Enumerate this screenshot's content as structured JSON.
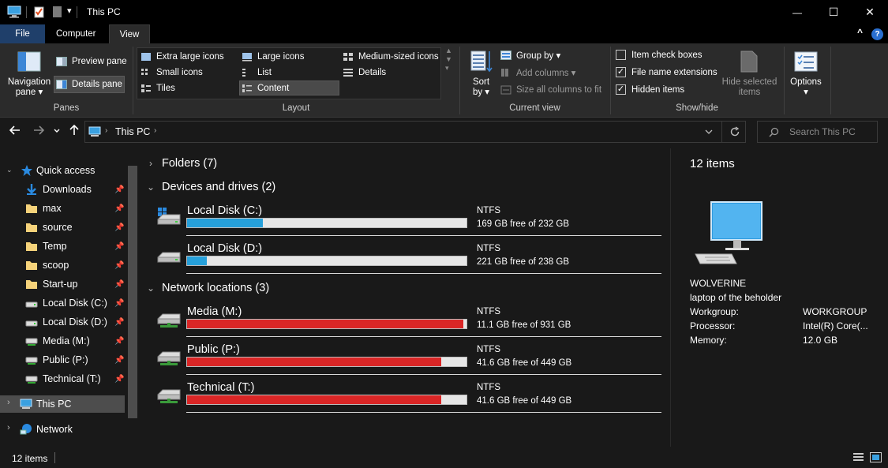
{
  "window": {
    "title": "This PC",
    "quick_access_dropdown": "▾",
    "minimize": "—",
    "maximize": "☐",
    "close": "✕"
  },
  "ribbon_tabs": [
    "File",
    "Computer",
    "View"
  ],
  "ribbon_help": "?",
  "ribbon_collapse": "^",
  "panes": {
    "navigation_pane_line1": "Navigation",
    "navigation_pane_line2": "pane ▾",
    "preview_pane": "Preview pane",
    "details_pane": "Details pane",
    "group_label": "Panes"
  },
  "layout": {
    "options": [
      "Extra large icons",
      "Large icons",
      "Medium-sized icons",
      "Small icons",
      "List",
      "Details",
      "Tiles",
      "Content"
    ],
    "selected": "Content",
    "group_label": "Layout"
  },
  "current_view": {
    "sort_by_line1": "Sort",
    "sort_by_line2": "by ▾",
    "group_by": "Group by ▾",
    "add_columns": "Add columns ▾",
    "size_columns": "Size all columns to fit",
    "group_label": "Current view"
  },
  "show_hide": {
    "item_check_boxes": "Item check boxes",
    "item_check_boxes_checked": false,
    "file_name_extensions": "File name extensions",
    "file_name_extensions_checked": true,
    "hidden_items": "Hidden items",
    "hidden_items_checked": true,
    "hide_selected_line1": "Hide selected",
    "hide_selected_line2": "items",
    "group_label": "Show/hide"
  },
  "options": {
    "label": "Options",
    "arrow": "▾"
  },
  "address": {
    "location": "This PC",
    "search_placeholder": "Search This PC"
  },
  "nav_pane": {
    "quick_access": "Quick access",
    "items": [
      {
        "label": "Downloads",
        "pinned": true
      },
      {
        "label": "max",
        "pinned": true
      },
      {
        "label": "source",
        "pinned": true
      },
      {
        "label": "Temp",
        "pinned": true
      },
      {
        "label": "scoop",
        "pinned": true
      },
      {
        "label": "Start-up",
        "pinned": true
      },
      {
        "label": "Local Disk (C:)",
        "pinned": true
      },
      {
        "label": "Local Disk (D:)",
        "pinned": true
      },
      {
        "label": "Media (M:)",
        "pinned": true
      },
      {
        "label": "Public (P:)",
        "pinned": true
      },
      {
        "label": "Technical (T:)",
        "pinned": true
      }
    ],
    "this_pc": "This PC",
    "network": "Network"
  },
  "content": {
    "folders_header": "Folders (7)",
    "devices_header": "Devices and drives (2)",
    "network_header": "Network locations (3)",
    "drives": [
      {
        "name": "Local Disk (C:)",
        "fs": "NTFS",
        "free": "169 GB free of 232 GB",
        "used_fraction": 0.27,
        "color": "#26a0da"
      },
      {
        "name": "Local Disk (D:)",
        "fs": "NTFS",
        "free": "221 GB free of 238 GB",
        "used_fraction": 0.07,
        "color": "#26a0da"
      }
    ],
    "network_drives": [
      {
        "name": "Media (M:)",
        "fs": "NTFS",
        "free": "11.1 GB free of 931 GB",
        "used_fraction": 0.99,
        "color": "#da2626"
      },
      {
        "name": "Public (P:)",
        "fs": "NTFS",
        "free": "41.6 GB free of 449 GB",
        "used_fraction": 0.91,
        "color": "#da2626"
      },
      {
        "name": "Technical (T:)",
        "fs": "NTFS",
        "free": "41.6 GB free of 449 GB",
        "used_fraction": 0.91,
        "color": "#da2626"
      }
    ]
  },
  "details_pane": {
    "count": "12 items",
    "computer_name": "WOLVERINE",
    "description": "laptop of the beholder",
    "fields": [
      {
        "label": "Workgroup:",
        "value": "WORKGROUP"
      },
      {
        "label": "Processor:",
        "value": "Intel(R) Core(..."
      },
      {
        "label": "Memory:",
        "value": "12.0 GB"
      }
    ]
  },
  "status": {
    "count": "12 items"
  },
  "colors": {
    "background": "#191919",
    "ribbon": "#2b2b2b",
    "file_tab": "#1f3f6a",
    "local_bar": "#26a0da",
    "network_bar": "#da2626"
  }
}
